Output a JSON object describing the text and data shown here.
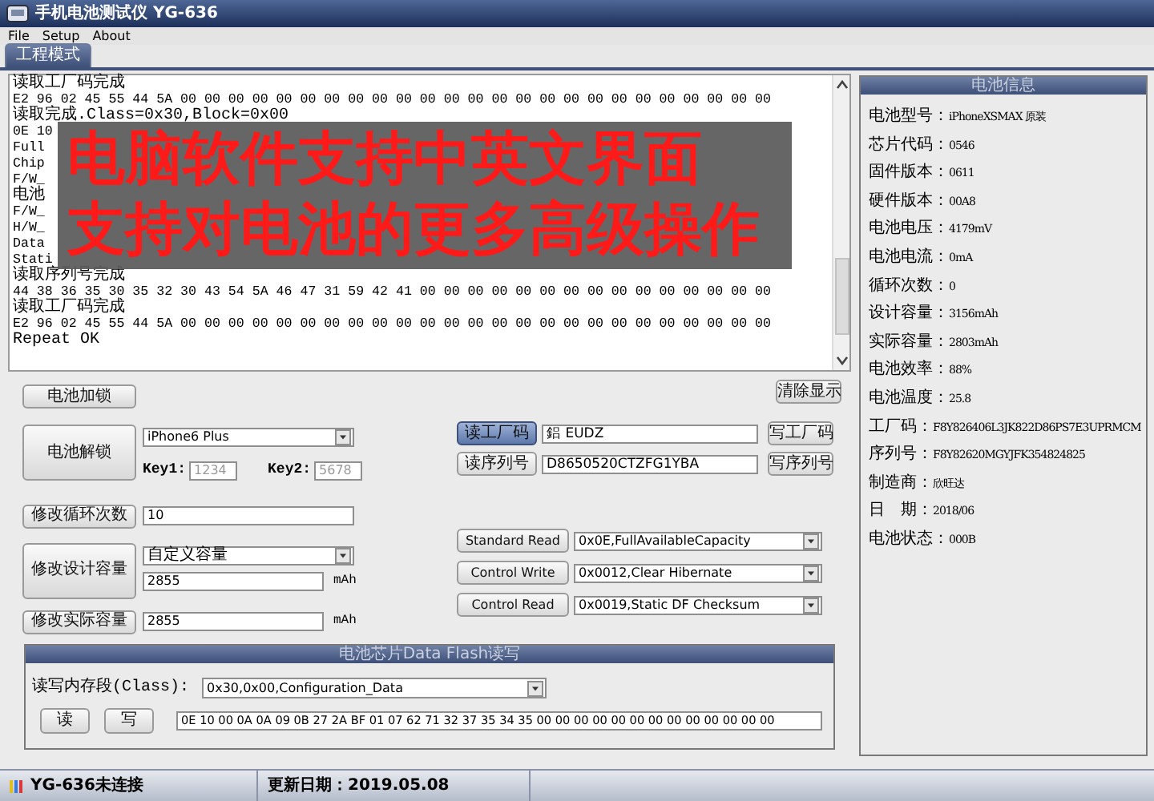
{
  "window": {
    "title": "手机电池测试仪 YG-636"
  },
  "menu": [
    "File",
    "Setup",
    "About"
  ],
  "tabs": [
    {
      "label": "工程模式",
      "selected": true
    }
  ],
  "log": {
    "lines": [
      {
        "kind": "message",
        "text": "读取工厂码完成"
      },
      {
        "kind": "hex",
        "text": "E2 96 02 45 55 44 5A 00 00 00 00 00 00 00 00 00 00 00 00 00 00 00 00 00 00 00 00 00 00 00 00 00"
      },
      {
        "kind": "message",
        "text": "读取完成.Class=0x30,Block=0x00"
      },
      {
        "kind": "hex",
        "text": "0E 10"
      },
      {
        "kind": "hex",
        "text": "Full"
      },
      {
        "kind": "hex",
        "text": "Chip"
      },
      {
        "kind": "hex",
        "text": "F/W_"
      },
      {
        "kind": "message",
        "text": "电池"
      },
      {
        "kind": "hex",
        "text": "F/W_"
      },
      {
        "kind": "hex",
        "text": "H/W_"
      },
      {
        "kind": "hex",
        "text": "Data"
      },
      {
        "kind": "hex",
        "text": "Stati"
      },
      {
        "kind": "message",
        "text": "读取序列号完成"
      },
      {
        "kind": "hex",
        "text": "44 38 36 35 30 35 32 30 43 54 5A 46 47 31 59 42 41 00 00 00 00 00 00 00 00 00 00 00 00 00 00 00"
      },
      {
        "kind": "message",
        "text": "读取工厂码完成"
      },
      {
        "kind": "hex",
        "text": "E2 96 02 45 55 44 5A 00 00 00 00 00 00 00 00 00 00 00 00 00 00 00 00 00 00 00 00 00 00 00 00 00"
      },
      {
        "kind": "message",
        "text": "Repeat OK"
      }
    ]
  },
  "caption": {
    "lines": [
      "电脑软件支持中英文界面",
      "支持对电池的更多高级操作"
    ]
  },
  "lock_button": "电池加锁",
  "clear_button": "清除显示",
  "unlock": {
    "button": "电池解锁",
    "model": "iPhone6 Plus",
    "keys": [
      {
        "label": "Key1:",
        "value": "1234",
        "disabled": true
      },
      {
        "label": "Key2:",
        "value": "5678",
        "disabled": true
      }
    ]
  },
  "cycle": {
    "button": "修改循环次数",
    "value": "10"
  },
  "design_capacity": {
    "button": "修改设计容量",
    "mode": "自定义容量",
    "value": "2855",
    "unit": "mAh"
  },
  "actual_capacity": {
    "button": "修改实际容量",
    "value": "2855",
    "unit": "mAh"
  },
  "codes": [
    {
      "read": "读工厂码",
      "value": "鋁 EUDZ",
      "write": "写工厂码",
      "focused": true
    },
    {
      "read": "读序列号",
      "value": "D8650520CTZFG1YBA",
      "write": "写序列号",
      "focused": false
    }
  ],
  "commands": [
    {
      "button": "Standard Read",
      "value": "0x0E,FullAvailableCapacity"
    },
    {
      "button": "Control Write",
      "value": "0x0012,Clear Hibernate"
    },
    {
      "button": "Control Read",
      "value": "0x0019,Static DF Checksum"
    }
  ],
  "data_flash": {
    "title": "电池芯片Data Flash读写",
    "class_label": "读写内存段(Class):",
    "class_value": "0x30,0x00,Configuration_Data",
    "read": "读",
    "write": "写",
    "data": "0E 10 00 0A 0A 09 0B 27 2A BF 01 07 62 71 32 37 35 34 35 00 00 00 00 00 00 00 00 00 00 00 00 00"
  },
  "info": {
    "title": "电池信息",
    "items": [
      {
        "label": "电池型号：",
        "value": "iPhoneXSMAX 原装"
      },
      {
        "label": "芯片代码：",
        "value": "0546"
      },
      {
        "label": "固件版本：",
        "value": "0611"
      },
      {
        "label": "硬件版本：",
        "value": "00A8"
      },
      {
        "label": "电池电压：",
        "value": "4179mV"
      },
      {
        "label": "电池电流：",
        "value": "0mA"
      },
      {
        "label": "循环次数：",
        "value": "0"
      },
      {
        "label": "设计容量：",
        "value": "3156mAh"
      },
      {
        "label": "实际容量：",
        "value": "2803mAh"
      },
      {
        "label": "电池效率：",
        "value": "88%"
      },
      {
        "label": "电池温度：",
        "value": "25.8"
      },
      {
        "label": "工厂码：",
        "value": "F8Y826406L3JK822D86PS7E3UPRMCM"
      },
      {
        "label": "序列号：",
        "value": "F8Y82620MGYJFK354824825"
      },
      {
        "label": "制造商：",
        "value": "欣旺达"
      },
      {
        "label": "日　期：",
        "value": "2018/06"
      },
      {
        "label": "电池状态：",
        "value": "000B"
      }
    ]
  },
  "status_bar": [
    "YG-636未连接",
    "更新日期：2019.05.08"
  ]
}
